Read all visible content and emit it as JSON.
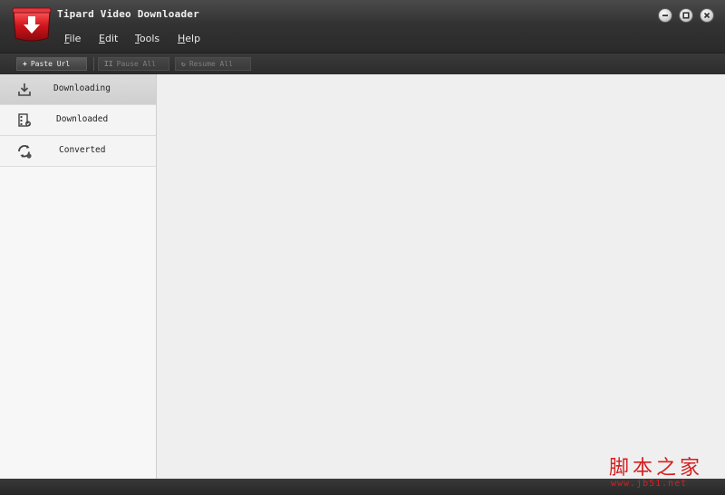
{
  "window": {
    "title": "Tipard Video Downloader",
    "controls": [
      "minimize",
      "maximize",
      "close"
    ]
  },
  "menu": [
    {
      "label": "File",
      "mnemonic": "F",
      "rest": "ile"
    },
    {
      "label": "Edit",
      "mnemonic": "E",
      "rest": "dit"
    },
    {
      "label": "Tools",
      "mnemonic": "T",
      "rest": "ools"
    },
    {
      "label": "Help",
      "mnemonic": "H",
      "rest": "elp"
    }
  ],
  "toolbar": {
    "paste_url": {
      "label": "Paste Url",
      "icon": "plus-icon",
      "enabled": true
    },
    "pause_all": {
      "label": "Pause All",
      "icon": "pause-icon",
      "enabled": false
    },
    "resume_all": {
      "label": "Resume All",
      "icon": "refresh-icon",
      "enabled": false
    }
  },
  "sidebar": {
    "items": [
      {
        "label": "Downloading",
        "icon": "download-tray-icon",
        "active": true
      },
      {
        "label": "Downloaded",
        "icon": "film-list-icon",
        "active": false
      },
      {
        "label": "Converted",
        "icon": "convert-cycle-icon",
        "active": false
      }
    ]
  },
  "watermark": {
    "text_cn": "脚本之家",
    "url": "www.jb51.net"
  },
  "colors": {
    "logo_red": "#c8161d",
    "watermark_red": "#d61f1f",
    "sidebar_active": "#d4d4d4",
    "content_bg": "#efefef"
  }
}
